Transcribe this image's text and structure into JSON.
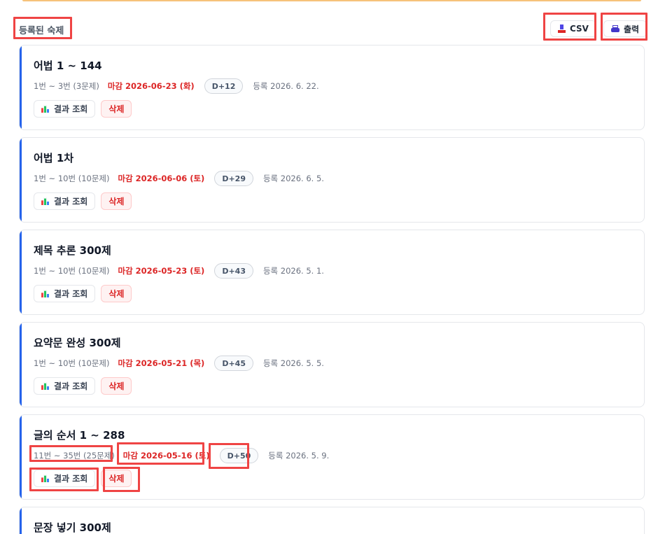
{
  "header": {
    "section_title": "등록된 숙제",
    "csv_label": "CSV",
    "print_label": "출력"
  },
  "homework": [
    {
      "title": "어법 1 ~ 144",
      "range": "1번 ~ 3번 (3문제)",
      "deadline": "마감 2026-06-23 (화)",
      "dday": "D+12",
      "registered": "등록 2026. 6. 22.",
      "result_label": "결과 조회",
      "delete_label": "삭제"
    },
    {
      "title": "어법 1차",
      "range": "1번 ~ 10번 (10문제)",
      "deadline": "마감 2026-06-06 (토)",
      "dday": "D+29",
      "registered": "등록 2026. 6. 5.",
      "result_label": "결과 조회",
      "delete_label": "삭제"
    },
    {
      "title": "제목 추론 300제",
      "range": "1번 ~ 10번 (10문제)",
      "deadline": "마감 2026-05-23 (토)",
      "dday": "D+43",
      "registered": "등록 2026. 5. 1.",
      "result_label": "결과 조회",
      "delete_label": "삭제"
    },
    {
      "title": "요약문 완성 300제",
      "range": "1번 ~ 10번 (10문제)",
      "deadline": "마감 2026-05-21 (목)",
      "dday": "D+45",
      "registered": "등록 2026. 5. 5.",
      "result_label": "결과 조회",
      "delete_label": "삭제"
    },
    {
      "title": "글의 순서 1 ~ 288",
      "range": "11번 ~ 35번 (25문제)",
      "deadline": "마감 2026-05-16 (토)",
      "dday": "D+50",
      "registered": "등록 2026. 5. 9.",
      "result_label": "결과 조회",
      "delete_label": "삭제"
    },
    {
      "title": "문장 넣기 300제"
    }
  ],
  "colors": {
    "accent": "#2563eb",
    "deadline": "#dc2626",
    "highlight": "#ef4444"
  }
}
